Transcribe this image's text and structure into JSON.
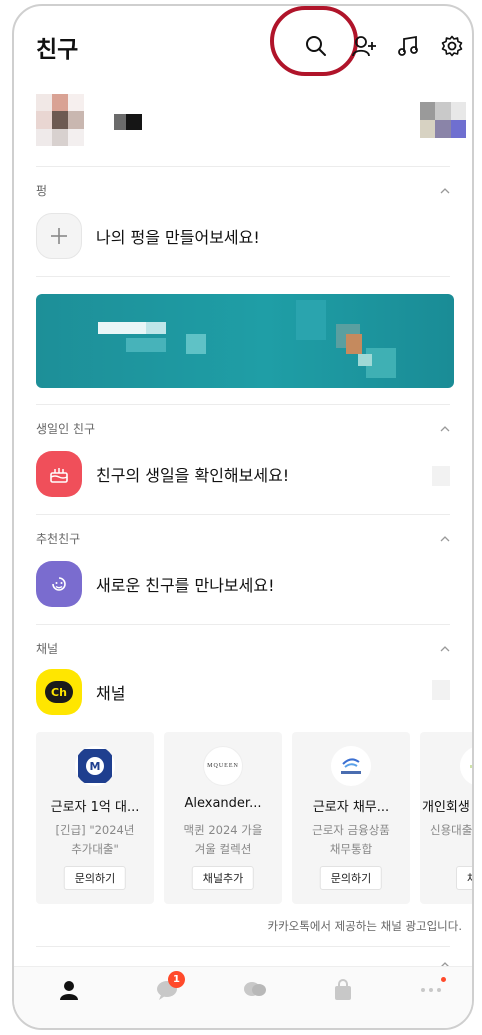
{
  "header": {
    "title": "친구",
    "icons": [
      "search-icon",
      "add-friend-icon",
      "music-icon",
      "settings-icon"
    ],
    "highlight_color": "#b0142a"
  },
  "pung": {
    "label": "펑",
    "create_text": "나의 펑을 만들어보세요!"
  },
  "birthday": {
    "label": "생일인 친구",
    "text": "친구의 생일을 확인해보세요!",
    "icon_color": "#f04f5a"
  },
  "recommended": {
    "label": "추천친구",
    "text": "새로운 친구를 만나보세요!",
    "icon_color": "#7a6ccf"
  },
  "channel": {
    "label": "채널",
    "title": "채널",
    "logo_text": "Ch",
    "icon_color": "#ffe600",
    "cards": [
      {
        "name": "근로자 1억 대...",
        "desc": "[긴급] \"2024년\n추가대출\"",
        "button": "문의하기",
        "logo": "M"
      },
      {
        "name": "Alexander...",
        "desc": "맥퀸 2024 가을\n겨울 컬렉션",
        "button": "채널추가",
        "logo": "MQUEEN"
      },
      {
        "name": "근로자 채무...",
        "desc": "근로자 금융상품\n채무통합",
        "button": "문의하기",
        "logo": ""
      },
      {
        "name": "개인회생",
        "desc": "신용대출",
        "button": "채널추",
        "logo": ""
      }
    ],
    "ad_note": "카카오톡에서 제공하는 채널 광고입니다."
  },
  "bottom_nav": {
    "items": [
      "friends-tab",
      "chats-tab",
      "openchat-tab",
      "shopping-tab",
      "more-tab"
    ],
    "chat_badge": "1"
  }
}
